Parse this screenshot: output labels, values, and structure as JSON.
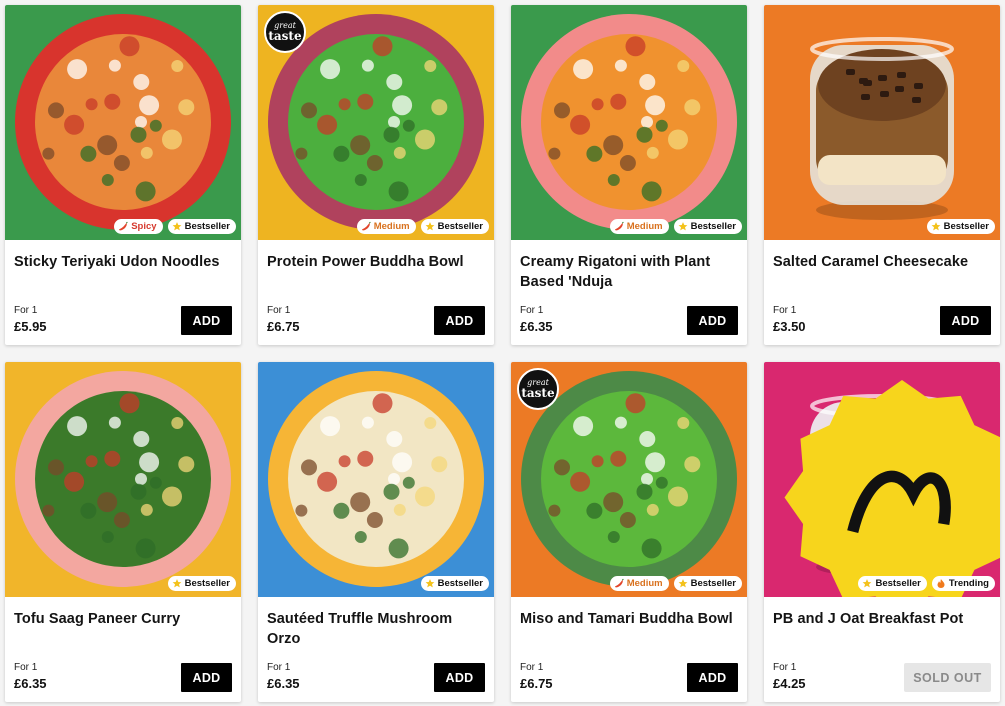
{
  "products": [
    {
      "title": "Sticky Teriyaki Udon Noodles",
      "portion": "For 1",
      "price": "£5.95",
      "action": "ADD",
      "badges": [
        {
          "type": "spicy",
          "label": "Spicy",
          "icon": "chili-icon"
        },
        {
          "type": "bestseller",
          "label": "Bestseller",
          "icon": "star-icon"
        }
      ],
      "bg": "#3a9a4c",
      "plate": "#d8342d",
      "food": "#e9873a"
    },
    {
      "title": "Protein Power Buddha Bowl",
      "portion": "For 1",
      "price": "£6.75",
      "action": "ADD",
      "award": {
        "top": "great",
        "bottom": "taste"
      },
      "badges": [
        {
          "type": "medium",
          "label": "Medium",
          "icon": "chili-icon"
        },
        {
          "type": "bestseller",
          "label": "Bestseller",
          "icon": "star-icon"
        }
      ],
      "bg": "#eeb421",
      "plate": "#b0425d",
      "food": "#4caf3e"
    },
    {
      "title": "Creamy Rigatoni with Plant Based 'Nduja",
      "portion": "For 1",
      "price": "£6.35",
      "action": "ADD",
      "badges": [
        {
          "type": "medium",
          "label": "Medium",
          "icon": "chili-icon"
        },
        {
          "type": "bestseller",
          "label": "Bestseller",
          "icon": "star-icon"
        }
      ],
      "bg": "#3a9a4c",
      "plate": "#f28b8a",
      "food": "#f0922f"
    },
    {
      "title": "Salted Caramel Cheesecake",
      "portion": "For 1",
      "price": "£3.50",
      "action": "ADD",
      "badges": [
        {
          "type": "bestseller",
          "label": "Bestseller",
          "icon": "star-icon"
        }
      ],
      "bg": "#ec7a25",
      "plate": "#e5e0d6",
      "food": "#8b5a2b"
    },
    {
      "title": "Tofu Saag Paneer Curry",
      "portion": "For 1",
      "price": "£6.35",
      "action": "ADD",
      "badges": [
        {
          "type": "bestseller",
          "label": "Bestseller",
          "icon": "star-icon"
        }
      ],
      "bg": "#f1b52a",
      "plate": "#f3a7a0",
      "food": "#3b7a2a"
    },
    {
      "title": "Sautéed Truffle Mushroom Orzo",
      "portion": "For 1",
      "price": "£6.35",
      "action": "ADD",
      "badges": [
        {
          "type": "bestseller",
          "label": "Bestseller",
          "icon": "star-icon"
        }
      ],
      "bg": "#3c8fd6",
      "plate": "#f6b536",
      "food": "#f2e6c4"
    },
    {
      "title": "Miso and Tamari Buddha Bowl",
      "portion": "For 1",
      "price": "£6.75",
      "action": "ADD",
      "award": {
        "top": "great",
        "bottom": "taste"
      },
      "badges": [
        {
          "type": "medium",
          "label": "Medium",
          "icon": "chili-icon"
        },
        {
          "type": "bestseller",
          "label": "Bestseller",
          "icon": "star-icon"
        }
      ],
      "bg": "#ec7a25",
      "plate": "#4d8a47",
      "food": "#5cb83c"
    },
    {
      "title": "PB and J Oat Breakfast Pot",
      "portion": "For 1",
      "price": "£4.25",
      "action": "SOLD OUT",
      "sold_out": true,
      "badges": [
        {
          "type": "bestseller",
          "label": "Bestseller",
          "icon": "star-icon"
        },
        {
          "type": "trending",
          "label": "Trending",
          "icon": "flame-icon"
        }
      ],
      "bg": "#d9286f",
      "plate": "#eef0f2",
      "food": "#e7e7e4"
    }
  ]
}
